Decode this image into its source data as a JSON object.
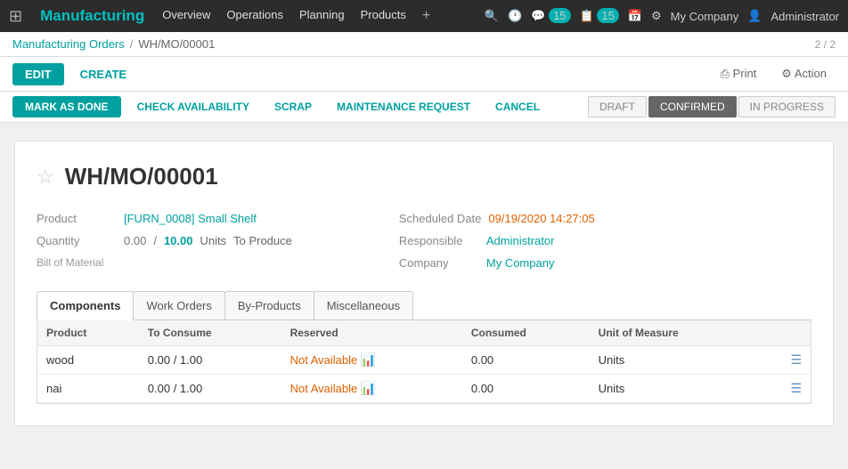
{
  "topNav": {
    "brand": "Manufacturing",
    "navItems": [
      "Overview",
      "Operations",
      "Planning",
      "Products"
    ],
    "rightItems": [
      "My Company",
      "Administrator"
    ]
  },
  "breadcrumb": {
    "parent": "Manufacturing Orders",
    "current": "WH/MO/00001"
  },
  "pageCount": "2 / 2",
  "actions": {
    "edit": "EDIT",
    "create": "CREATE",
    "print": "Print",
    "action": "Action"
  },
  "statusActions": {
    "markAsDone": "MARK AS DONE",
    "checkAvailability": "CHECK AVAILABILITY",
    "scrap": "SCRAP",
    "maintenanceRequest": "MAINTENANCE REQUEST",
    "cancel": "CANCEL"
  },
  "stages": [
    {
      "label": "DRAFT",
      "active": false
    },
    {
      "label": "CONFIRMED",
      "active": true
    },
    {
      "label": "IN PROGRESS",
      "active": false
    }
  ],
  "form": {
    "title": "WH/MO/00001",
    "fields": {
      "product": {
        "label": "Product",
        "value": "[FURN_0008] Small Shelf"
      },
      "quantity": {
        "label": "Quantity",
        "produced": "0.00",
        "separator": "/",
        "target": "10.00",
        "unit": "Units",
        "unitLabel": "To Produce"
      },
      "billOfMaterial": {
        "label": "Bill of Material",
        "value": ""
      },
      "scheduledDate": {
        "label": "Scheduled Date",
        "value": "09/19/2020 14:27:05"
      },
      "responsible": {
        "label": "Responsible",
        "value": "Administrator"
      },
      "company": {
        "label": "Company",
        "value": "My Company"
      }
    },
    "tabs": [
      {
        "label": "Components",
        "active": true
      },
      {
        "label": "Work Orders",
        "active": false
      },
      {
        "label": "By-Products",
        "active": false
      },
      {
        "label": "Miscellaneous",
        "active": false
      }
    ],
    "tableHeaders": [
      "Product",
      "To Consume",
      "Reserved",
      "Consumed",
      "Unit of Measure"
    ],
    "tableRows": [
      {
        "product": "wood",
        "toConsume": "0.00 / 1.00",
        "reserved": "Not Available",
        "consumed": "0.00",
        "unit": "Units"
      },
      {
        "product": "nai",
        "toConsume": "0.00 / 1.00",
        "reserved": "Not Available",
        "consumed": "0.00",
        "unit": "Units"
      }
    ]
  }
}
